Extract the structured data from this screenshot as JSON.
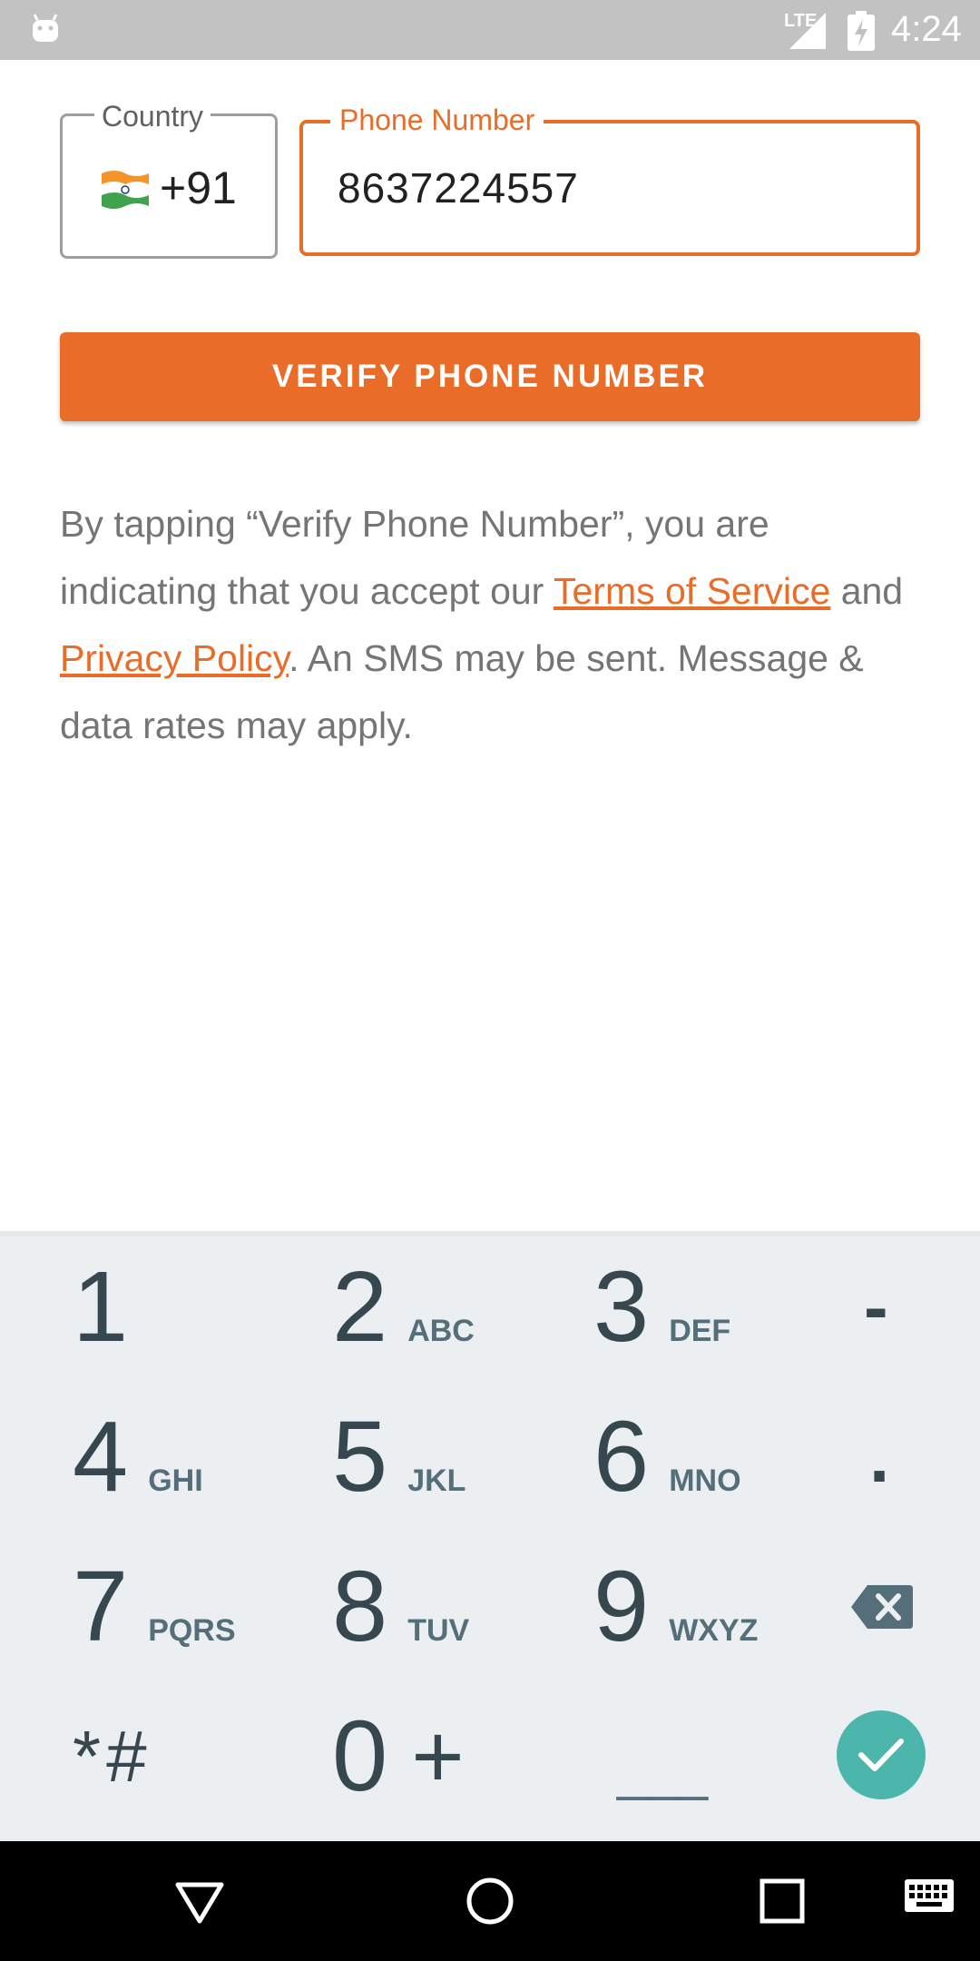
{
  "status_bar": {
    "network": "LTE",
    "time": "4:24"
  },
  "form": {
    "country_label": "Country",
    "country_code": "+91",
    "phone_label": "Phone Number",
    "phone_value": "8637224557"
  },
  "verify_button": {
    "label": "VERIFY PHONE NUMBER"
  },
  "terms": {
    "text_before": "By tapping “Verify Phone Number”, you are indicating that you accept our ",
    "terms_link": "Terms of Service",
    "text_middle": " and ",
    "privacy_link": "Privacy Policy",
    "text_after": ". An SMS may be sent. Message & data rates may apply."
  },
  "keyboard": {
    "keys": [
      {
        "num": "1",
        "letters": ""
      },
      {
        "num": "2",
        "letters": "ABC"
      },
      {
        "num": "3",
        "letters": "DEF"
      },
      {
        "num": "4",
        "letters": "GHI"
      },
      {
        "num": "5",
        "letters": "JKL"
      },
      {
        "num": "6",
        "letters": "MNO"
      },
      {
        "num": "7",
        "letters": "PQRS"
      },
      {
        "num": "8",
        "letters": "TUV"
      },
      {
        "num": "9",
        "letters": "WXYZ"
      },
      {
        "num": "0",
        "letters": "+"
      }
    ],
    "dash": "-",
    "dot": ".",
    "star_hash": "*#",
    "space": "___"
  },
  "colors": {
    "accent": "#e96c28",
    "done": "#4db6ac"
  }
}
